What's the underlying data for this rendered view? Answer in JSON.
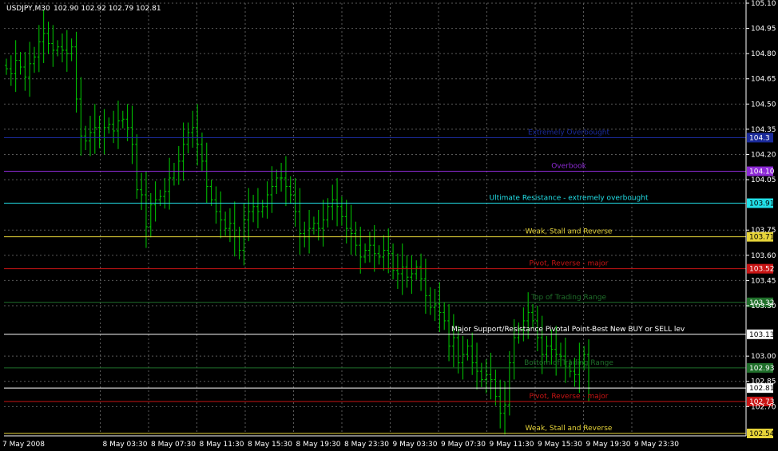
{
  "header": {
    "symbol": "USDJPY,M30",
    "ohlc": "102.90 102.92 102.79 102.81"
  },
  "colors": {
    "background": "#000000",
    "grid": "#5a5a5a",
    "axis": "#ffffff",
    "candle": "#00cc00"
  },
  "chart_data": {
    "type": "bar",
    "symbol": "USDJPY,M30",
    "ylim": [
      102.54,
      105.1
    ],
    "grid": true,
    "y_ticks": [
      "105.10",
      "104.95",
      "104.80",
      "104.65",
      "104.50",
      "104.35",
      "104.20",
      "104.05",
      "103.75",
      "103.60",
      "103.45",
      "103.30",
      "103.00",
      "102.85",
      "102.70"
    ],
    "x_ticks": [
      "7 May 2008",
      "8 May 03:30",
      "8 May 07:30",
      "8 May 11:30",
      "8 May 15:30",
      "8 May 19:30",
      "8 May 23:30",
      "9 May 03:30",
      "9 May 07:30",
      "9 May 11:30",
      "9 May 15:30",
      "9 May 19:30",
      "9 May 23:30"
    ],
    "close_series": [
      104.71,
      104.68,
      104.76,
      104.72,
      104.66,
      104.74,
      104.78,
      104.87,
      104.92,
      104.86,
      104.82,
      104.84,
      104.82,
      104.8,
      104.84,
      104.53,
      104.31,
      104.28,
      104.33,
      104.36,
      104.3,
      104.36,
      104.38,
      104.34,
      104.4,
      104.41,
      104.36,
      104.26,
      103.99,
      103.96,
      103.77,
      103.9,
      103.93,
      103.95,
      103.98,
      104.06,
      104.1,
      104.16,
      104.26,
      104.33,
      104.36,
      104.26,
      104.16,
      104.01,
      103.93,
      103.86,
      103.81,
      103.76,
      103.79,
      103.71,
      103.63,
      103.81,
      103.86,
      103.89,
      103.86,
      103.89,
      103.96,
      104.01,
      104.06,
      104.06,
      104.01,
      103.96,
      103.86,
      103.73,
      103.71,
      103.76,
      103.79,
      103.76,
      103.81,
      103.89,
      103.93,
      103.89,
      103.83,
      103.76,
      103.73,
      103.66,
      103.59,
      103.63,
      103.66,
      103.61,
      103.59,
      103.63,
      103.61,
      103.51,
      103.49,
      103.53,
      103.47,
      103.49,
      103.53,
      103.46,
      103.36,
      103.29,
      103.31,
      103.26,
      103.21,
      103.06,
      103.11,
      102.96,
      103.01,
      103.06,
      102.96,
      102.91,
      102.86,
      102.89,
      102.86,
      102.76,
      102.66,
      102.71,
      102.96,
      103.11,
      103.16,
      103.21,
      103.26,
      103.21,
      103.11,
      103.01,
      103.06,
      103.04,
      103.01,
      103.0,
      102.94,
      102.91,
      102.89,
      102.96,
      103.01,
      102.81
    ],
    "levels": [
      {
        "price": 104.3,
        "tag": "104.3",
        "label": "Extremely Overbought",
        "color": "#1a2a9a"
      },
      {
        "price": 104.1,
        "tag": "104.10",
        "label": "Overbook",
        "color": "#8e2ad6"
      },
      {
        "price": 103.91,
        "tag": "103.91",
        "label": "Ultimate Resistance - extremely overbought",
        "color": "#22e0e8"
      },
      {
        "price": 103.71,
        "tag": "103.71",
        "label": "Weak, Stall and Reverse",
        "color": "#e6d43a"
      },
      {
        "price": 103.52,
        "tag": "103.52",
        "label": "Pivot, Reverse - major",
        "color": "#c81414"
      },
      {
        "price": 103.32,
        "tag": "103.32",
        "label": "Top of Trading Range",
        "color": "#1f6f2a"
      },
      {
        "price": 103.13,
        "tag": "103.13",
        "label": "Major Support/Resistance Pivotal Point-Best New BUY or SELL lev",
        "color": "#ffffff"
      },
      {
        "price": 102.93,
        "tag": "102.93",
        "label": "Bottom of Trading Range",
        "color": "#1f6f2a"
      },
      {
        "price": 102.81,
        "tag": "102.81",
        "label": "",
        "color": "#ffffff"
      },
      {
        "price": 102.73,
        "tag": "102.73",
        "label": "Pivot, Reverse - major",
        "color": "#c81414"
      },
      {
        "price": 102.54,
        "tag": "102.54",
        "label": "Weak, Stall and Reverse",
        "color": "#e6d43a"
      }
    ]
  }
}
